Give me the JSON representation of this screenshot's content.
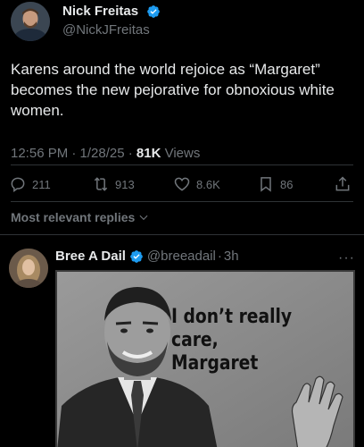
{
  "tweet": {
    "author_name": "Nick Freitas",
    "author_handle": "@NickJFreitas",
    "text": "Karens around the world rejoice as “Margaret” becomes the new pejorative for obnoxious white women.",
    "timestamp": "12:56 PM · 1/28/25 · ",
    "views_count": "81K",
    "views_label": " Views",
    "stats": {
      "replies": "211",
      "reposts": "913",
      "likes": "8.6K",
      "bookmarks": "86"
    }
  },
  "replies_filter": {
    "label": "Most relevant replies"
  },
  "reply": {
    "author_name": "Bree A Dail",
    "author_handle": "@breeadail",
    "separator": "·",
    "time": "3h",
    "more": "···",
    "meme_text": "I don’t really care, Margaret"
  },
  "colors": {
    "background": "#000000",
    "text_primary": "#e7e9ea",
    "text_secondary": "#71767b",
    "verified_blue": "#1d9bf0",
    "divider": "#2f3336"
  }
}
